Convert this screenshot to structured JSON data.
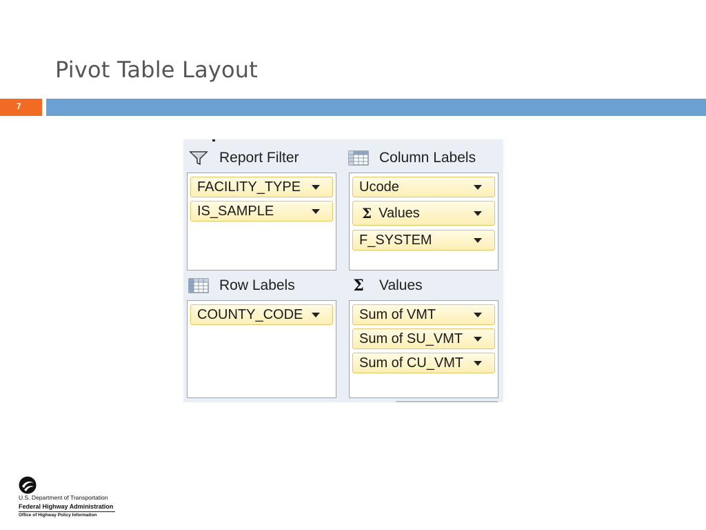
{
  "slide": {
    "title": "Pivot Table Layout",
    "number": "7"
  },
  "colors": {
    "accent_orange": "#f26b23",
    "title_bar_blue": "#6aa0d2",
    "chip_border": "#e3c56a",
    "chip_fill": "#fdefb5"
  },
  "pivot": {
    "report_filter": {
      "label": "Report Filter",
      "icon": "filter-funnel-icon",
      "fields": [
        "FACILITY_TYPE",
        "IS_SAMPLE"
      ]
    },
    "column_labels": {
      "label": "Column Labels",
      "icon": "table-grid-icon",
      "fields": [
        "Ucode",
        "Values",
        "F_SYSTEM"
      ]
    },
    "row_labels": {
      "label": "Row Labels",
      "icon": "table-grid-icon",
      "fields": [
        "COUNTY_CODE"
      ]
    },
    "values": {
      "label": "Values",
      "icon": "sigma-icon",
      "fields": [
        "Sum of VMT",
        "Sum of SU_VMT",
        "Sum of CU_VMT"
      ]
    }
  },
  "footer": {
    "line1": "U.S. Department of Transportation",
    "line2": "Federal Highway Administration",
    "line3": "Office of Highway Policy Information"
  }
}
